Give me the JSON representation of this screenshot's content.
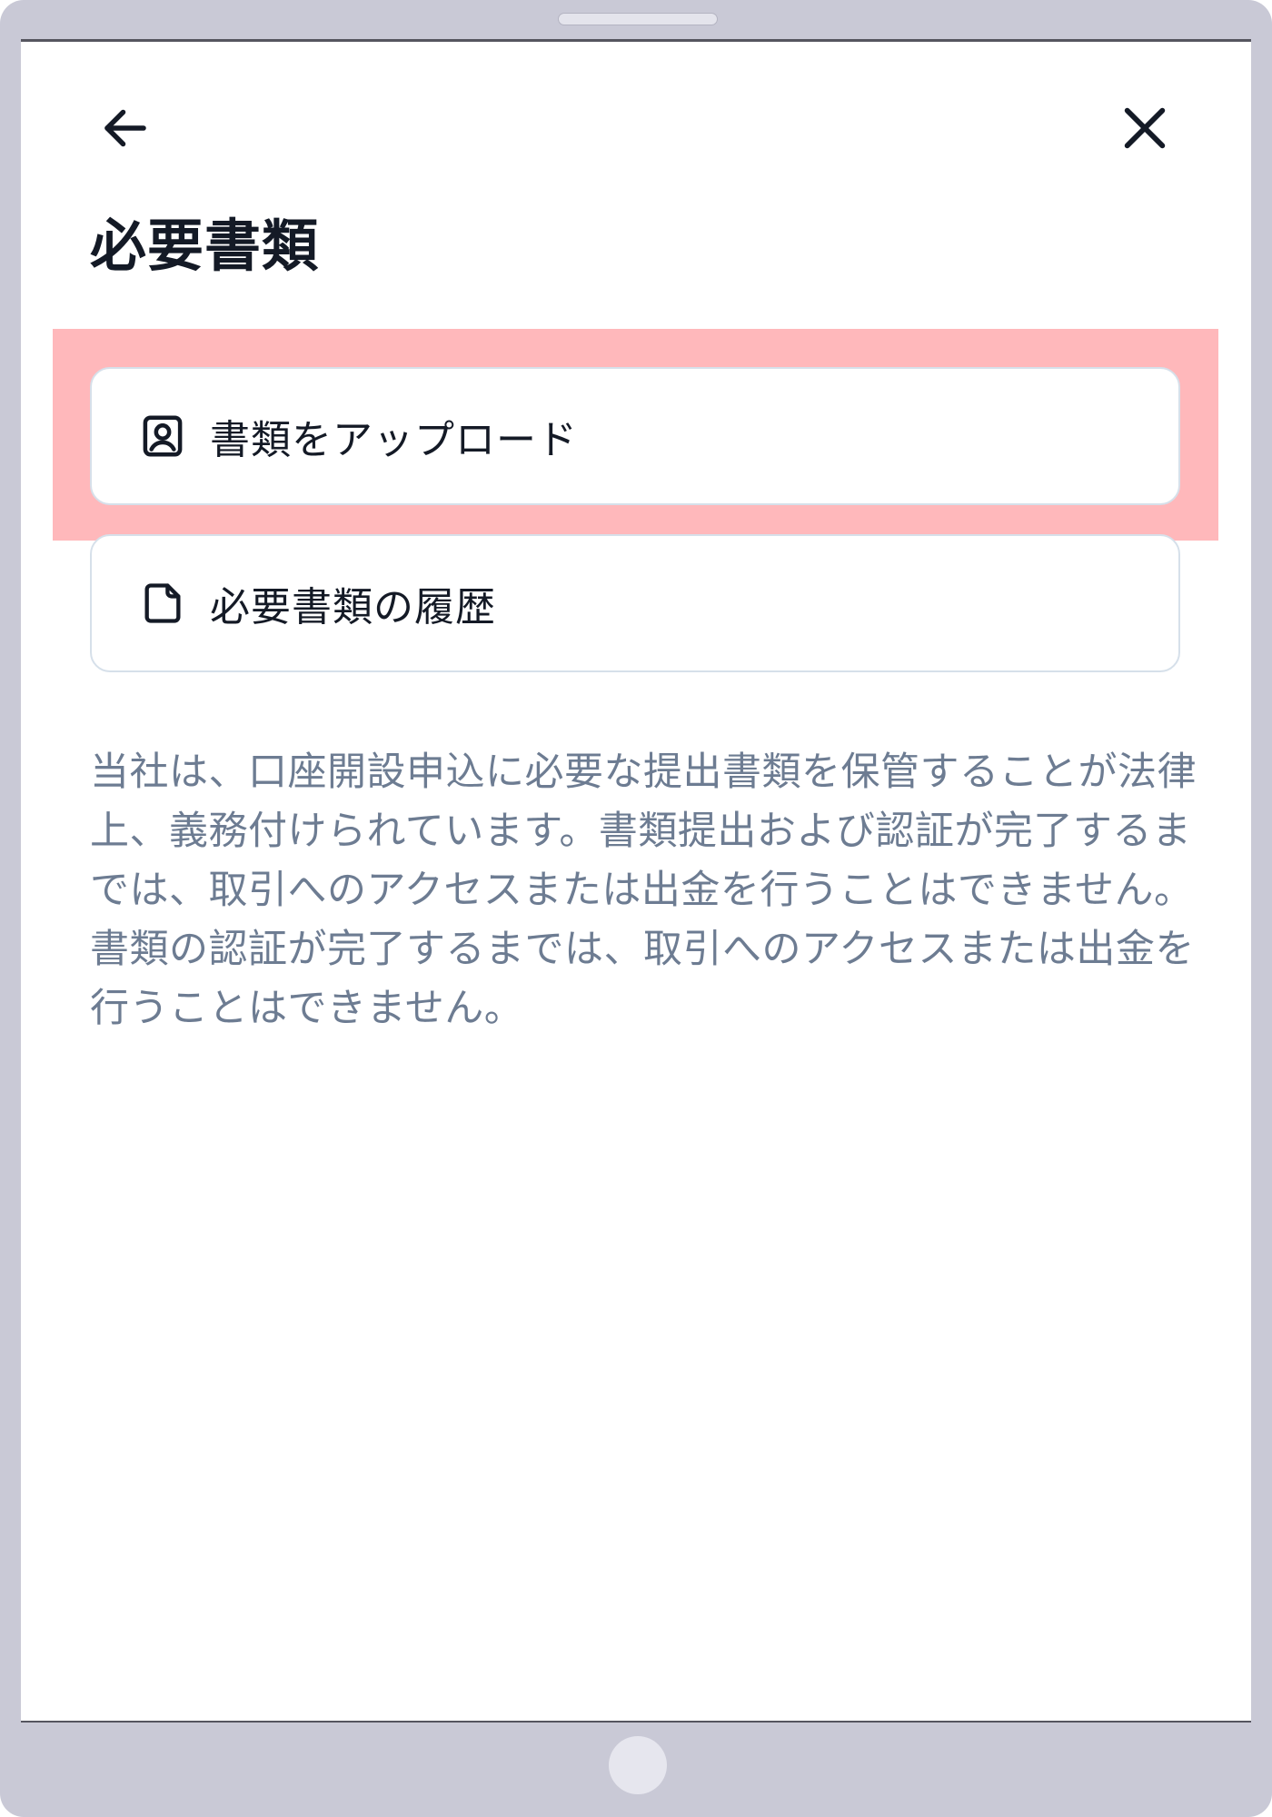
{
  "page": {
    "title": "必要書類"
  },
  "options": [
    {
      "label": "書類をアップロード",
      "icon": "user-document-icon"
    },
    {
      "label": "必要書類の履歴",
      "icon": "document-icon"
    }
  ],
  "description": "当社は、口座開設申込に必要な提出書類を保管することが法律上、義務付けられています。書類提出および認証が完了するまでは、取引へのアクセスまたは出金を行うことはできません。 書類の認証が完了するまでは、取引へのアクセスまたは出金を行うことはできません。",
  "colors": {
    "title_text": "#141a26",
    "body_text": "#6d7c92",
    "card_border": "#d6e0ea",
    "highlight": "#ffb8bb",
    "device_frame": "#c9c9d6"
  }
}
